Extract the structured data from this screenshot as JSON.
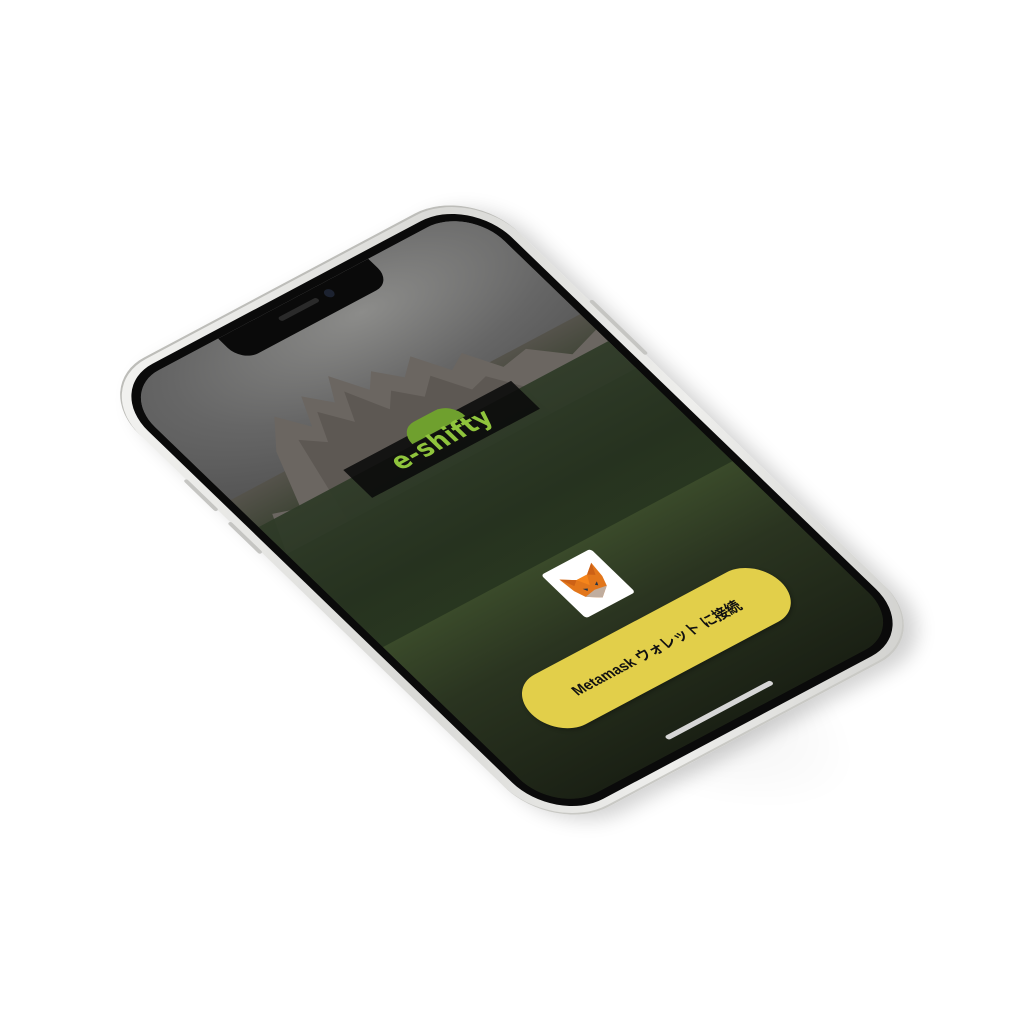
{
  "app": {
    "brand_name": "e-shifty",
    "connect_button_label": "Metamask ウォレット に接続"
  },
  "icons": {
    "wallet_icon": "metamask-fox-icon"
  },
  "colors": {
    "brand_green": "#8fc43c",
    "button_yellow": "#e2cf4a",
    "band_dark": "#0a0a0a",
    "phone_silver": "#e2e2df"
  }
}
